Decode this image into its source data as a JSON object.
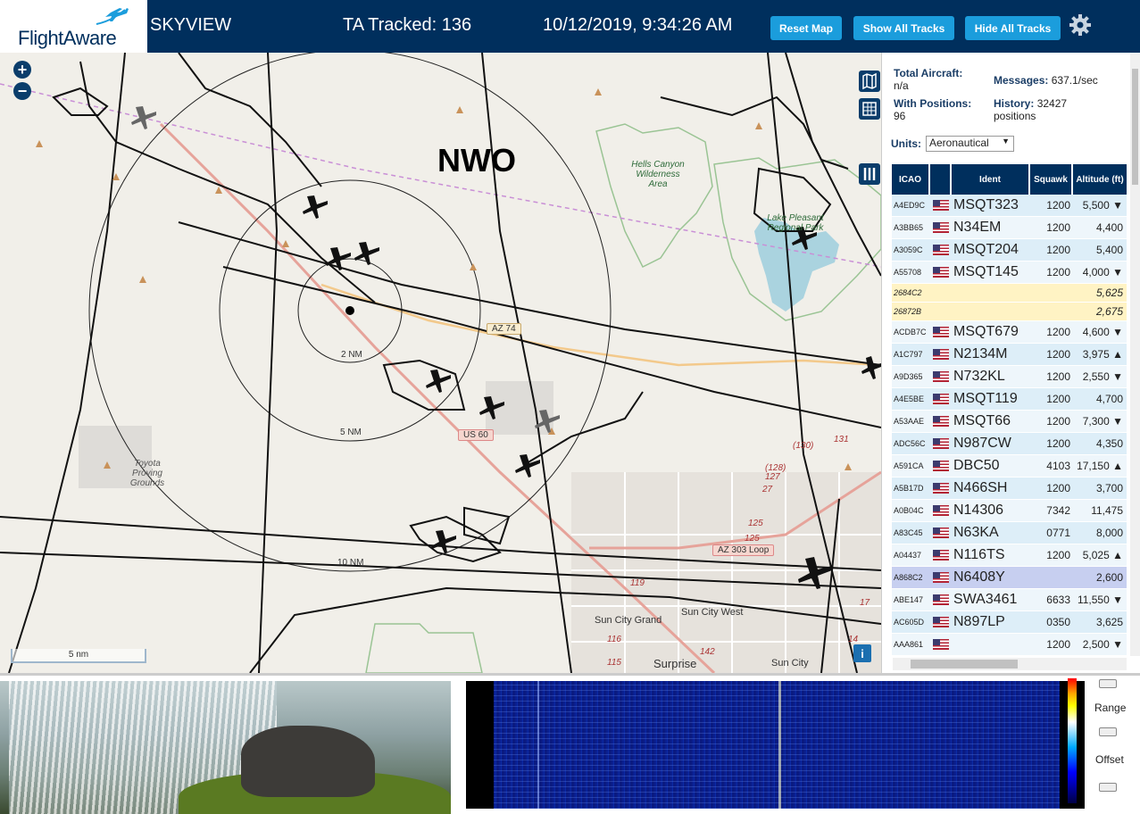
{
  "header": {
    "logo": "FlightAware",
    "app_title": "SKYVIEW",
    "ta_tracked": "TA Tracked: 136",
    "datetime": "10/12/2019, 9:34:26 AM",
    "buttons": {
      "reset_map": "Reset Map",
      "show_all": "Show All Tracks",
      "hide_all": "Hide All Tracks"
    },
    "colors": {
      "bar": "#002f5d",
      "button": "#1b9ddc"
    }
  },
  "map": {
    "zoom_in": "+",
    "zoom_out": "−",
    "station_label": "NWO",
    "range_rings": [
      "2 NM",
      "5 NM",
      "10 NM"
    ],
    "roads": [
      "AZ 74",
      "US 60",
      "AZ 303 Loop"
    ],
    "places": [
      "Sun City Grand",
      "Sun City West",
      "Surprise",
      "Sun City"
    ],
    "parks": {
      "hells_canyon": "Hells Canyon Wilderness Area",
      "lake_pleasant": "Lake Pleasant Regional Park"
    },
    "toyota": "Toyota Proving Grounds",
    "route_numbers": [
      "(130)",
      "131",
      "(128)",
      "127",
      "27",
      "125",
      "125",
      "119",
      "116",
      "115",
      "142",
      "17",
      "14"
    ],
    "scale_label": "5 nm",
    "info_button": "i"
  },
  "sidebar": {
    "total_aircraft_label": "Total Aircraft:",
    "total_aircraft_value": "n/a",
    "with_positions_label": "With Positions:",
    "with_positions_value": "96",
    "messages_label": "Messages:",
    "messages_value": "637.1/sec",
    "history_label": "History:",
    "history_value": "32427 positions",
    "units_label": "Units:",
    "units_value": "Aeronautical",
    "columns": [
      "ICAO",
      "",
      "Ident",
      "Squawk",
      "Altitude (ft)"
    ],
    "rows": [
      {
        "icao": "A4ED9C",
        "ident": "MSQT323",
        "squawk": "1200",
        "alt": "5,500 ▼",
        "type": "even"
      },
      {
        "icao": "A3BB65",
        "ident": "N34EM",
        "squawk": "1200",
        "alt": "4,400",
        "type": "odd"
      },
      {
        "icao": "A3059C",
        "ident": "MSQT204",
        "squawk": "1200",
        "alt": "5,400",
        "type": "even"
      },
      {
        "icao": "A55708",
        "ident": "MSQT145",
        "squawk": "1200",
        "alt": "4,000 ▼",
        "type": "odd"
      },
      {
        "icao": "2684C2",
        "ident": "",
        "squawk": "",
        "alt": "5,625",
        "type": "mlat"
      },
      {
        "icao": "26872B",
        "ident": "",
        "squawk": "",
        "alt": "2,675",
        "type": "mlat"
      },
      {
        "icao": "ACDB7C",
        "ident": "MSQT679",
        "squawk": "1200",
        "alt": "4,600 ▼",
        "type": "odd"
      },
      {
        "icao": "A1C797",
        "ident": "N2134M",
        "squawk": "1200",
        "alt": "3,975 ▲",
        "type": "even"
      },
      {
        "icao": "A9D365",
        "ident": "N732KL",
        "squawk": "1200",
        "alt": "2,550 ▼",
        "type": "odd"
      },
      {
        "icao": "A4E5BE",
        "ident": "MSQT119",
        "squawk": "1200",
        "alt": "4,700",
        "type": "even"
      },
      {
        "icao": "A53AAE",
        "ident": "MSQT66",
        "squawk": "1200",
        "alt": "7,300 ▼",
        "type": "odd"
      },
      {
        "icao": "ADC56C",
        "ident": "N987CW",
        "squawk": "1200",
        "alt": "4,350",
        "type": "even"
      },
      {
        "icao": "A591CA",
        "ident": "DBC50",
        "squawk": "4103",
        "alt": "17,150 ▲",
        "type": "odd"
      },
      {
        "icao": "A5B17D",
        "ident": "N466SH",
        "squawk": "1200",
        "alt": "3,700",
        "type": "even"
      },
      {
        "icao": "A0B04C",
        "ident": "N14306",
        "squawk": "7342",
        "alt": "11,475",
        "type": "odd"
      },
      {
        "icao": "A83C45",
        "ident": "N63KA",
        "squawk": "0771",
        "alt": "8,000",
        "type": "even"
      },
      {
        "icao": "A04437",
        "ident": "N116TS",
        "squawk": "1200",
        "alt": "5,025 ▲",
        "type": "odd"
      },
      {
        "icao": "A868C2",
        "ident": "N6408Y",
        "squawk": "",
        "alt": "2,600",
        "type": "sel"
      },
      {
        "icao": "ABE147",
        "ident": "SWA3461",
        "squawk": "6633",
        "alt": "11,550 ▼",
        "type": "odd"
      },
      {
        "icao": "AC605D",
        "ident": "N897LP",
        "squawk": "0350",
        "alt": "3,625",
        "type": "even"
      },
      {
        "icao": "AAA861",
        "ident": "",
        "squawk": "1200",
        "alt": "2,500 ▼",
        "type": "odd"
      }
    ]
  },
  "bottom": {
    "range_label": "Range",
    "offset_label": "Offset"
  }
}
